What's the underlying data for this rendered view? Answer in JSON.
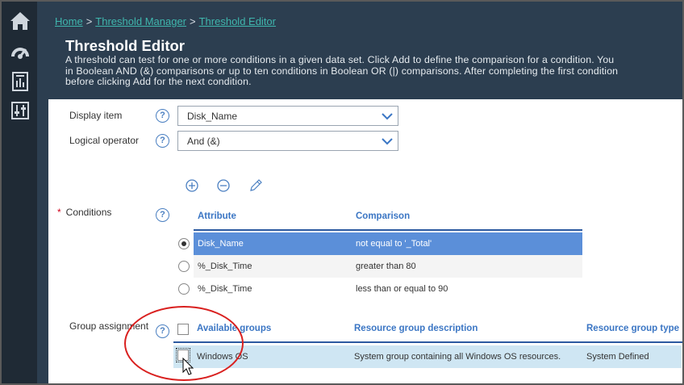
{
  "breadcrumb": {
    "home": "Home",
    "threshold_manager": "Threshold Manager",
    "threshold_editor": "Threshold Editor",
    "separator": ">"
  },
  "header": {
    "title": "Threshold Editor",
    "description": "A threshold can test for one or more conditions in a given data set. Click Add to define the comparison for a condition. You\nin Boolean AND (&) comparisons or up to ten conditions in Boolean OR (|) comparisons. After completing the first condition\nbefore clicking Add for the next condition."
  },
  "form": {
    "display_item_label": "Display item",
    "display_item_value": "Disk_Name",
    "logical_operator_label": "Logical operator",
    "logical_operator_value": "And (&)",
    "conditions_label": "Conditions",
    "required_marker": "*",
    "group_assignment_label": "Group assignment",
    "help_glyph": "?"
  },
  "conditions": {
    "columns": [
      "Attribute",
      "Comparison"
    ],
    "rows": [
      {
        "attribute": "Disk_Name",
        "comparison": "not  equal to '_Total'",
        "selected": true
      },
      {
        "attribute": "%_Disk_Time",
        "comparison": "greater  than 80",
        "selected": false
      },
      {
        "attribute": "%_Disk_Time",
        "comparison": "less  than or equal to 90",
        "selected": false
      }
    ]
  },
  "groups": {
    "columns": [
      "Available groups",
      "Resource group description",
      "Resource group type"
    ],
    "rows": [
      {
        "name": "Windows OS",
        "description": "System group containing all Windows OS resources.",
        "type": "System Defined",
        "checked": false
      }
    ]
  },
  "icons": {
    "rail": [
      "home-icon",
      "dashboard-gauge-icon",
      "report-icon",
      "settings-sliders-icon"
    ],
    "toolbar": [
      "add-circle-icon",
      "remove-circle-icon",
      "edit-pencil-icon"
    ]
  },
  "colors": {
    "header_bg": "#2c3e50",
    "rail_bg": "#1f2a35",
    "link": "#3fb6ad",
    "accent_blue": "#3b76c4",
    "selected_row": "#5b8fd9",
    "group_row": "#cfe6f3",
    "annotation_red": "#d9201f"
  }
}
